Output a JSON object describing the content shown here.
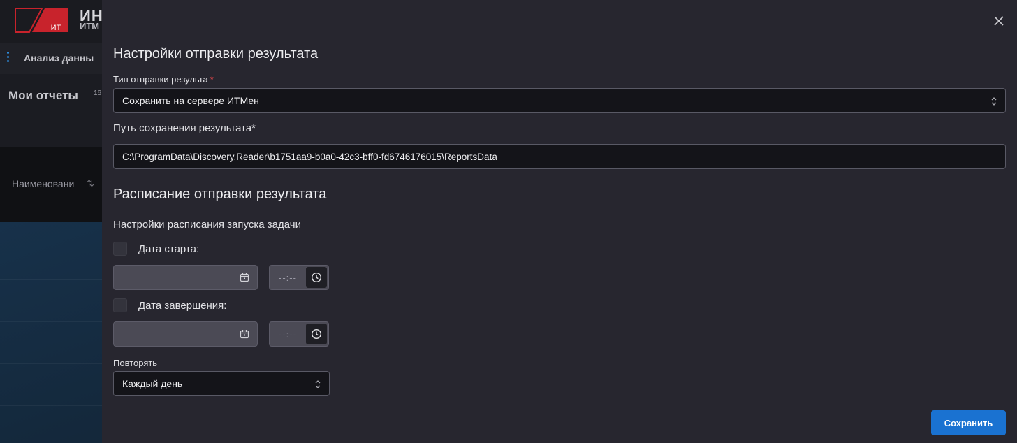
{
  "background": {
    "logo": {
      "text_main": "ИН",
      "text_sub": "ИТМ",
      "badge": "ИТ"
    },
    "subbar_title": "Анализ данны",
    "reports_title": "Мои отчеты",
    "reports_count": "16",
    "column_name": "Наименовани",
    "sort_icon": "sort-arrows-icon"
  },
  "drawer": {
    "close_icon": "close-icon",
    "section1_title": "Настройки отправки результата",
    "send_type": {
      "label": "Тип отправки результа",
      "required_mark": "*",
      "value": "Сохранить на сервере ИТМен"
    },
    "save_path": {
      "label": "Путь сохранения результата*",
      "value": "C:\\ProgramData\\Discovery.Reader\\b1751aa9-b0a0-42c3-bff0-fd6746176015\\ReportsData"
    },
    "section2_title": "Расписание отправки результата",
    "schedule_settings_label": "Настройки расписания запуска задачи",
    "start": {
      "label": "Дата старта:",
      "checked": false,
      "date_value": "",
      "time_placeholder": "--:--"
    },
    "end": {
      "label": "Дата завершения:",
      "checked": false,
      "date_value": "",
      "time_placeholder": "--:--"
    },
    "repeat": {
      "label": "Повторять",
      "value": "Каждый день"
    },
    "save_label": "Сохранить"
  },
  "colors": {
    "accent": "#1a72d1",
    "logo_red": "#c8232c",
    "required": "#e0464a",
    "drawer_bg": "#27262f"
  }
}
